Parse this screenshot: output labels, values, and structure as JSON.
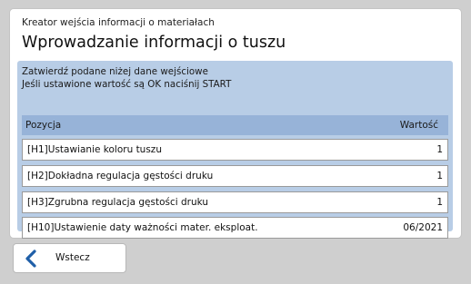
{
  "header": {
    "subtitle": "Kreator wejścia informacji o materiałach",
    "title": "Wprowadzanie informacji o tuszu"
  },
  "info": {
    "line1": "Zatwierdź podane niżej dane wejściowe",
    "line2": "Jeśli ustawione wartość są OK naciśnij START"
  },
  "table": {
    "columns": {
      "position": "Pozycja",
      "value": "Wartość"
    },
    "rows": [
      {
        "label": "[H1]Ustawianie koloru tuszu",
        "value": "1"
      },
      {
        "label": "[H2]Dokładna regulacja gęstości druku",
        "value": "1"
      },
      {
        "label": "[H3]Zgrubna regulacja gęstości druku",
        "value": "1"
      },
      {
        "label": "[H10]Ustawienie daty ważności mater. eksploat.",
        "value": "06/2021"
      }
    ]
  },
  "footer": {
    "back_label": "Wstecz",
    "back_icon": "chevron-left-icon"
  },
  "colors": {
    "background": "#cfcfcf",
    "panel": "#ffffff",
    "info_box": "#b8cde6",
    "table_header": "#97b3d8",
    "accent_icon": "#1f5fa8"
  }
}
